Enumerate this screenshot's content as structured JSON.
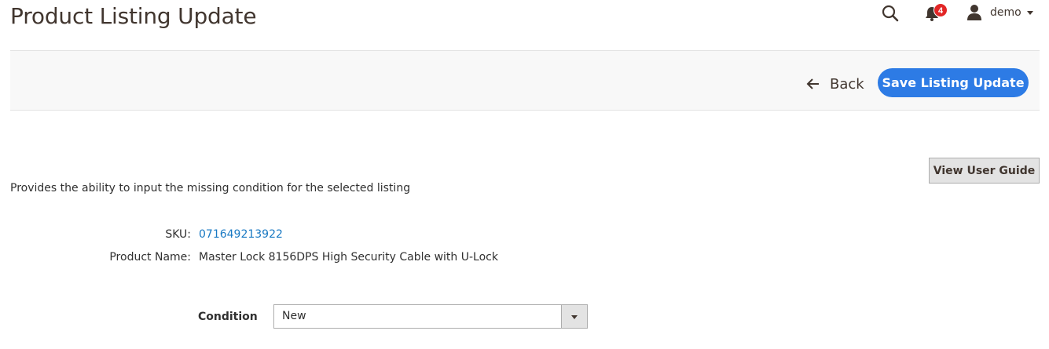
{
  "header": {
    "title": "Product Listing Update",
    "notifications_count": "4",
    "user_name": "demo",
    "icons": {
      "search": "search-icon",
      "notifications": "bell-icon",
      "user": "user-icon"
    }
  },
  "toolbar": {
    "back_label": "Back",
    "save_label": "Save Listing Update",
    "accent_color": "#2d7be5"
  },
  "guide": {
    "label": "View User Guide"
  },
  "main": {
    "description": "Provides the ability to input the missing condition for the selected listing",
    "sku_label": "SKU:",
    "sku_value": "071649213922",
    "product_name_label": "Product Name:",
    "product_name_value": "Master Lock 8156DPS High Security Cable with U-Lock",
    "condition_label": "Condition",
    "condition_value": "New"
  },
  "colors": {
    "notification_badge": "#e22626",
    "link": "#1979c3"
  }
}
